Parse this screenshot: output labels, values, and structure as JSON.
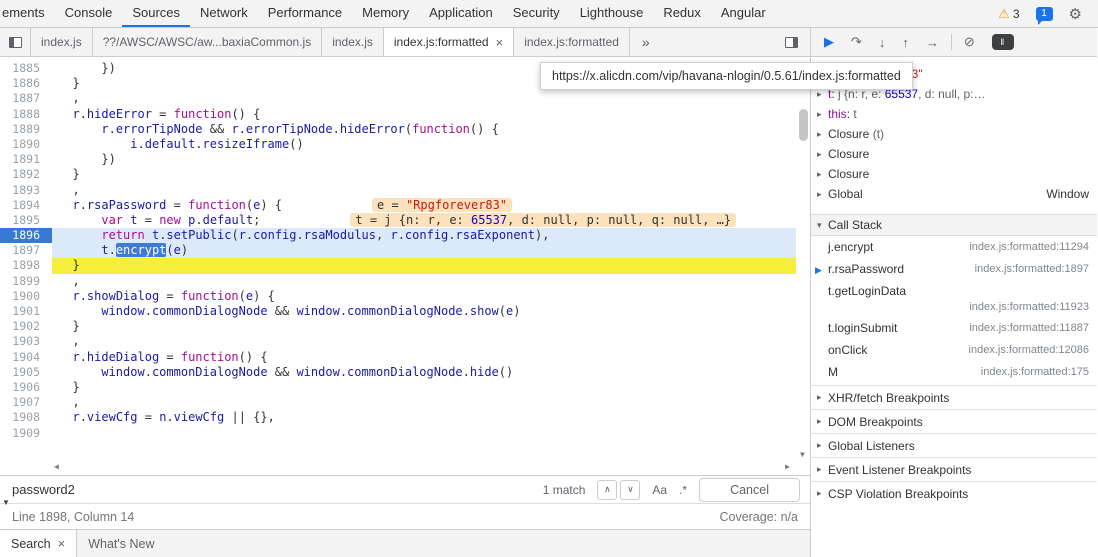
{
  "colors": {
    "accent_blue": "#1a73e8",
    "exec_line_bg": "#dce9f9",
    "exec_gutter_bg": "#3879d6",
    "flash_line_bg": "#f6ee3c",
    "inline_hint_bg": "#fbe2bc",
    "selected_token_bg": "#3e7bd6",
    "keyword": "#aa0d91",
    "variable": "#1a1aa6",
    "number": "#1c00cf",
    "string": "#c41a16"
  },
  "top_bar": {
    "tabs": [
      {
        "label": "ements"
      },
      {
        "label": "Console"
      },
      {
        "label": "Sources",
        "active": true
      },
      {
        "label": "Network"
      },
      {
        "label": "Performance"
      },
      {
        "label": "Memory"
      },
      {
        "label": "Application"
      },
      {
        "label": "Security"
      },
      {
        "label": "Lighthouse"
      },
      {
        "label": "Redux"
      },
      {
        "label": "Angular"
      }
    ],
    "warning_count": "3",
    "message_count": "1"
  },
  "file_tab_bar": {
    "tabs": [
      {
        "label": "index.js"
      },
      {
        "label": "??/AWSC/AWSC/aw...baxiaCommon.js"
      },
      {
        "label": "index.js"
      },
      {
        "label": "index.js:formatted",
        "active": true,
        "closable": true
      },
      {
        "label": "index.js:formatted"
      }
    ],
    "overflow_chevron": "»"
  },
  "tooltip": {
    "text": "https://x.alicdn.com/vip/havana-nlogin/0.5.61/index.js:formatted"
  },
  "editor": {
    "lines": [
      {
        "num": "1885",
        "indent": 6,
        "tokens": [
          [
            "})",
            "p"
          ]
        ]
      },
      {
        "num": "1886",
        "indent": 2,
        "tokens": [
          [
            "}",
            "p"
          ]
        ]
      },
      {
        "num": "1887",
        "indent": 2,
        "tokens": [
          [
            ",",
            "p"
          ]
        ]
      },
      {
        "num": "1888",
        "indent": 2,
        "tokens": [
          [
            "r",
            "v"
          ],
          [
            ".",
            "p"
          ],
          [
            "hideError",
            "v"
          ],
          [
            " = ",
            "p"
          ],
          [
            "function",
            "k"
          ],
          [
            "() {",
            "p"
          ]
        ]
      },
      {
        "num": "1889",
        "indent": 6,
        "tokens": [
          [
            "r",
            "v"
          ],
          [
            ".",
            "p"
          ],
          [
            "errorTipNode",
            "v"
          ],
          [
            " && ",
            "p"
          ],
          [
            "r",
            "v"
          ],
          [
            ".",
            "p"
          ],
          [
            "errorTipNode",
            "v"
          ],
          [
            ".",
            "p"
          ],
          [
            "hideError",
            "v"
          ],
          [
            "(",
            "p"
          ],
          [
            "function",
            "k"
          ],
          [
            "() {",
            "p"
          ]
        ]
      },
      {
        "num": "1890",
        "indent": 10,
        "tokens": [
          [
            "i",
            "v"
          ],
          [
            ".",
            "p"
          ],
          [
            "default",
            "v"
          ],
          [
            ".",
            "p"
          ],
          [
            "resizeIframe",
            "v"
          ],
          [
            "()",
            "p"
          ]
        ]
      },
      {
        "num": "1891",
        "indent": 6,
        "tokens": [
          [
            "})",
            "p"
          ]
        ]
      },
      {
        "num": "1892",
        "indent": 2,
        "tokens": [
          [
            "}",
            "p"
          ]
        ]
      },
      {
        "num": "1893",
        "indent": 2,
        "tokens": [
          [
            ",",
            "p"
          ]
        ]
      },
      {
        "num": "1894",
        "indent": 2,
        "tokens": [
          [
            "r",
            "v"
          ],
          [
            ".",
            "p"
          ],
          [
            "rsaPassword",
            "v"
          ],
          [
            " = ",
            "p"
          ],
          [
            "function",
            "k"
          ],
          [
            "(",
            "p"
          ],
          [
            "e",
            "v"
          ],
          [
            ") {",
            "p"
          ]
        ],
        "hint": [
          [
            "e = ",
            "d"
          ],
          [
            "\"Rpgforever83\"",
            "s"
          ]
        ]
      },
      {
        "num": "1895",
        "indent": 6,
        "tokens": [
          [
            "var",
            "k"
          ],
          [
            " ",
            "p"
          ],
          [
            "t",
            "v"
          ],
          [
            " = ",
            "p"
          ],
          [
            "new",
            "k"
          ],
          [
            " ",
            "p"
          ],
          [
            "p",
            "v"
          ],
          [
            ".",
            "p"
          ],
          [
            "default",
            "v"
          ],
          [
            ";",
            "p"
          ]
        ],
        "hint": [
          [
            "t = j {n: r, e: ",
            "d"
          ],
          [
            "65537",
            "n"
          ],
          [
            ", d: null, p: null, q: null, …}",
            "d"
          ]
        ]
      },
      {
        "num": "1896",
        "indent": 6,
        "state": "exec",
        "tokens": [
          [
            "return",
            "k"
          ],
          [
            " ",
            "p"
          ],
          [
            "t",
            "v"
          ],
          [
            ".",
            "p"
          ],
          [
            "setPublic",
            "v"
          ],
          [
            "(",
            "p"
          ],
          [
            "r",
            "v"
          ],
          [
            ".",
            "p"
          ],
          [
            "config",
            "v"
          ],
          [
            ".",
            "p"
          ],
          [
            "rsaModulus",
            "v"
          ],
          [
            ", ",
            "p"
          ],
          [
            "r",
            "v"
          ],
          [
            ".",
            "p"
          ],
          [
            "config",
            "v"
          ],
          [
            ".",
            "p"
          ],
          [
            "rsaExponent",
            "v"
          ],
          [
            "),",
            "p"
          ]
        ]
      },
      {
        "num": "1897",
        "indent": 6,
        "state": "exec2",
        "tokens": [
          [
            "t",
            "v"
          ],
          [
            ".",
            "p"
          ],
          [
            "encrypt",
            "sel"
          ],
          [
            "(",
            "p"
          ],
          [
            "e",
            "v"
          ],
          [
            ")",
            "p"
          ]
        ]
      },
      {
        "num": "1898",
        "indent": 2,
        "state": "flash",
        "tokens": [
          [
            "}",
            "p"
          ]
        ]
      },
      {
        "num": "1899",
        "indent": 2,
        "tokens": [
          [
            ",",
            "p"
          ]
        ]
      },
      {
        "num": "1900",
        "indent": 2,
        "tokens": [
          [
            "r",
            "v"
          ],
          [
            ".",
            "p"
          ],
          [
            "showDialog",
            "v"
          ],
          [
            " = ",
            "p"
          ],
          [
            "function",
            "k"
          ],
          [
            "(",
            "p"
          ],
          [
            "e",
            "v"
          ],
          [
            ") {",
            "p"
          ]
        ]
      },
      {
        "num": "1901",
        "indent": 6,
        "tokens": [
          [
            "window",
            "v"
          ],
          [
            ".",
            "p"
          ],
          [
            "commonDialogNode",
            "v"
          ],
          [
            " && ",
            "p"
          ],
          [
            "window",
            "v"
          ],
          [
            ".",
            "p"
          ],
          [
            "commonDialogNode",
            "v"
          ],
          [
            ".",
            "p"
          ],
          [
            "show",
            "v"
          ],
          [
            "(",
            "p"
          ],
          [
            "e",
            "v"
          ],
          [
            ")",
            "p"
          ]
        ]
      },
      {
        "num": "1902",
        "indent": 2,
        "tokens": [
          [
            "}",
            "p"
          ]
        ]
      },
      {
        "num": "1903",
        "indent": 2,
        "tokens": [
          [
            ",",
            "p"
          ]
        ]
      },
      {
        "num": "1904",
        "indent": 2,
        "tokens": [
          [
            "r",
            "v"
          ],
          [
            ".",
            "p"
          ],
          [
            "hideDialog",
            "v"
          ],
          [
            " = ",
            "p"
          ],
          [
            "function",
            "k"
          ],
          [
            "() {",
            "p"
          ]
        ]
      },
      {
        "num": "1905",
        "indent": 6,
        "tokens": [
          [
            "window",
            "v"
          ],
          [
            ".",
            "p"
          ],
          [
            "commonDialogNode",
            "v"
          ],
          [
            " && ",
            "p"
          ],
          [
            "window",
            "v"
          ],
          [
            ".",
            "p"
          ],
          [
            "commonDialogNode",
            "v"
          ],
          [
            ".",
            "p"
          ],
          [
            "hide",
            "v"
          ],
          [
            "()",
            "p"
          ]
        ]
      },
      {
        "num": "1906",
        "indent": 2,
        "tokens": [
          [
            "}",
            "p"
          ]
        ]
      },
      {
        "num": "1907",
        "indent": 2,
        "tokens": [
          [
            ",",
            "p"
          ]
        ]
      },
      {
        "num": "1908",
        "indent": 2,
        "tokens": [
          [
            "r",
            "v"
          ],
          [
            ".",
            "p"
          ],
          [
            "viewCfg",
            "v"
          ],
          [
            " = ",
            "p"
          ],
          [
            "n",
            "v"
          ],
          [
            ".",
            "p"
          ],
          [
            "viewCfg",
            "v"
          ],
          [
            " ",
            "p"
          ],
          [
            "||",
            "p"
          ],
          [
            " ",
            "p"
          ],
          [
            "{},",
            "p"
          ]
        ]
      },
      {
        "num": "1909",
        "indent": 0,
        "tokens": []
      }
    ]
  },
  "debugger_toolbar": {
    "buttons": [
      {
        "name": "resume-icon",
        "glyph": "▶",
        "style": "blue"
      },
      {
        "name": "step-over-icon",
        "glyph": "↷"
      },
      {
        "name": "step-into-icon",
        "glyph": "↓"
      },
      {
        "name": "step-out-icon",
        "glyph": "↑"
      },
      {
        "name": "step-icon",
        "glyph": "→"
      },
      {
        "name": "deactivate-breakpoints-icon",
        "glyph": "⊘"
      },
      {
        "name": "pause-on-exceptions-icon",
        "glyph": "‖",
        "style": "dark"
      }
    ]
  },
  "sidebar": {
    "scope": {
      "rows": [
        {
          "partial": true,
          "expandable": false,
          "tokens": [
            [
              "e",
              "name"
            ],
            [
              ": ",
              "plain"
            ],
            [
              "\"Rpgforever83\"",
              "string"
            ]
          ]
        },
        {
          "expandable": true,
          "tokens": [
            [
              "t",
              "name"
            ],
            [
              ": ",
              "plain"
            ],
            [
              "j {n: r, e: ",
              "preview"
            ],
            [
              "65537",
              "number"
            ],
            [
              ", d: null, p:…",
              "preview"
            ]
          ]
        },
        {
          "expandable": true,
          "tokens": [
            [
              "this",
              "name"
            ],
            [
              ": ",
              "plain"
            ],
            [
              "t",
              "preview"
            ]
          ]
        },
        {
          "expandable": true,
          "tokens": [
            [
              "Closure",
              "plain"
            ],
            [
              " (t)",
              "preview"
            ]
          ]
        },
        {
          "expandable": true,
          "tokens": [
            [
              "Closure",
              "plain"
            ]
          ]
        },
        {
          "expandable": true,
          "tokens": [
            [
              "Closure",
              "plain"
            ]
          ]
        },
        {
          "expandable": true,
          "tokens": [
            [
              "Global",
              "plain"
            ]
          ],
          "right_value": "Window"
        }
      ]
    },
    "call_stack": {
      "title": "Call Stack",
      "frames": [
        {
          "name": "j.encrypt",
          "location": "index.js:formatted:11294"
        },
        {
          "name": "r.rsaPassword",
          "location": "index.js:formatted:1897",
          "current": true
        },
        {
          "name": "t.getLoginData",
          "location": "index.js:formatted:11923",
          "wrap": true
        },
        {
          "name": "t.loginSubmit",
          "location": "index.js:formatted:11887"
        },
        {
          "name": "onClick",
          "location": "index.js:formatted:12086"
        },
        {
          "name": "M",
          "location": "index.js:formatted:175"
        }
      ]
    },
    "collapsed_sections": [
      {
        "label": "XHR/fetch Breakpoints"
      },
      {
        "label": "DOM Breakpoints"
      },
      {
        "label": "Global Listeners"
      },
      {
        "label": "Event Listener Breakpoints"
      },
      {
        "label": "CSP Violation Breakpoints"
      }
    ]
  },
  "search_bar": {
    "value": "password2",
    "match_count": "1 match",
    "prev_glyph": "∧",
    "next_glyph": "∨",
    "case_toggle": "Aa",
    "regex_toggle": ".*",
    "cancel_label": "Cancel"
  },
  "status_bar": {
    "position": "Line 1898, Column 14",
    "coverage": "Coverage: n/a"
  },
  "drawer": {
    "tabs": [
      {
        "label": "Search",
        "active": true,
        "closable": true
      },
      {
        "label": "What's New"
      }
    ]
  }
}
